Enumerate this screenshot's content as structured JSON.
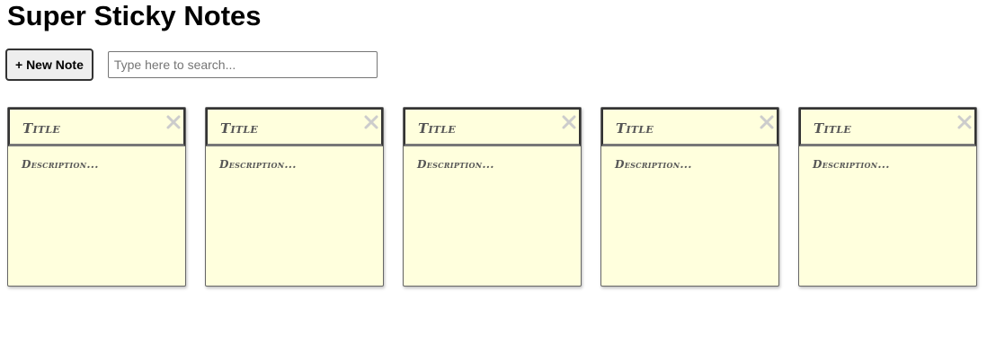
{
  "header": {
    "title": "Super Sticky Notes"
  },
  "toolbar": {
    "new_note_label": "+ New Note",
    "search_placeholder": "Type here to search..."
  },
  "notes": [
    {
      "title": "Title",
      "description": "Description..."
    },
    {
      "title": "Title",
      "description": "Description..."
    },
    {
      "title": "Title",
      "description": "Description..."
    },
    {
      "title": "Title",
      "description": "Description..."
    },
    {
      "title": "Title",
      "description": "Description..."
    }
  ],
  "icons": {
    "close": "close-icon"
  },
  "colors": {
    "note_background": "#ffffdd",
    "note_text": "#555555",
    "close_icon": "#cccccc"
  }
}
